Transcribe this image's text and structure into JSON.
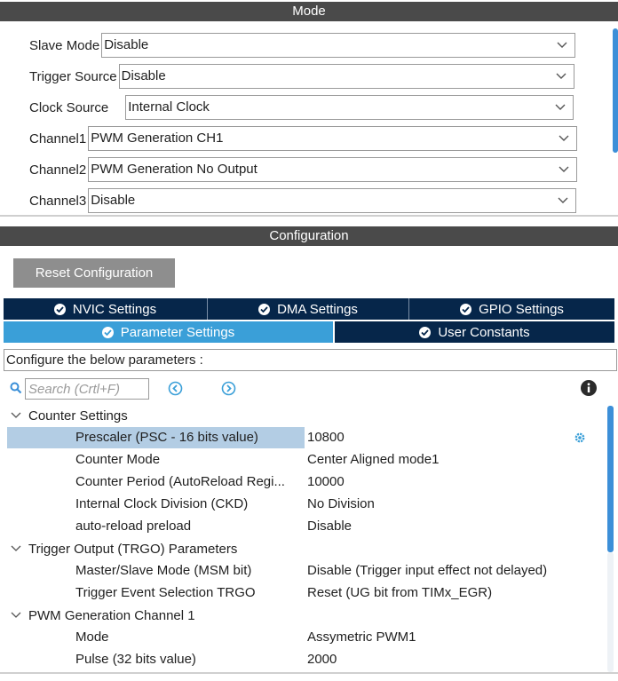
{
  "mode": {
    "header": "Mode",
    "fields": [
      {
        "label": "Slave Mode",
        "value": "Disable"
      },
      {
        "label": "Trigger Source",
        "value": "Disable"
      },
      {
        "label": "Clock Source",
        "value": "Internal Clock"
      },
      {
        "label": "Channel1",
        "value": "PWM Generation CH1"
      },
      {
        "label": "Channel2",
        "value": "PWM Generation No Output"
      },
      {
        "label": "Channel3",
        "value": "Disable"
      }
    ]
  },
  "configuration": {
    "header": "Configuration",
    "reset_label": "Reset Configuration",
    "tabs_top": [
      {
        "label": "NVIC Settings"
      },
      {
        "label": "DMA Settings"
      },
      {
        "label": "GPIO Settings"
      }
    ],
    "tabs_bottom": [
      {
        "label": "Parameter Settings",
        "active": true
      },
      {
        "label": "User Constants",
        "active": false
      }
    ],
    "describe": "Configure the below parameters :",
    "search_placeholder": "Search (Crtl+F)"
  },
  "params": {
    "groups": [
      {
        "name": "Counter Settings",
        "items": [
          {
            "name": "Prescaler (PSC - 16 bits value)",
            "value": "10800",
            "selected": true
          },
          {
            "name": "Counter Mode",
            "value": "Center Aligned mode1"
          },
          {
            "name": "Counter Period (AutoReload Regi...",
            "value": "10000"
          },
          {
            "name": "Internal Clock Division (CKD)",
            "value": "No Division"
          },
          {
            "name": "auto-reload preload",
            "value": "Disable"
          }
        ]
      },
      {
        "name": "Trigger Output (TRGO) Parameters",
        "items": [
          {
            "name": "Master/Slave Mode (MSM bit)",
            "value": "Disable (Trigger input effect not delayed)"
          },
          {
            "name": "Trigger Event Selection TRGO",
            "value": "Reset (UG bit from TIMx_EGR)"
          }
        ]
      },
      {
        "name": "PWM Generation Channel 1",
        "items": [
          {
            "name": "Mode",
            "value": "Assymetric PWM1"
          },
          {
            "name": "Pulse (32 bits value)",
            "value": "2000"
          }
        ]
      }
    ]
  },
  "colors": {
    "header_bg": "#4a4a4a",
    "tab_dark": "#06264a",
    "tab_active": "#3a9fd8",
    "selection": "#b3cde4",
    "accent": "#3c8fd8"
  }
}
